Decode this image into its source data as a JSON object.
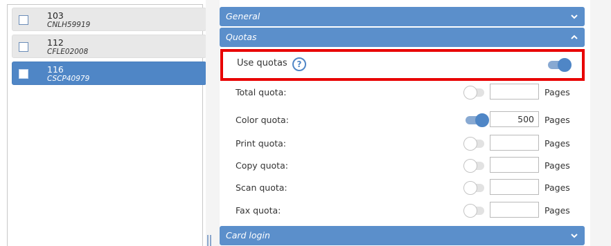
{
  "devices": [
    {
      "id": "103",
      "code": "CNLH59919",
      "selected": false
    },
    {
      "id": "112",
      "code": "CFLE02008",
      "selected": false
    },
    {
      "id": "116",
      "code": "CSCP40979",
      "selected": true
    }
  ],
  "sections": {
    "general": {
      "label": "General",
      "expanded": false
    },
    "quotas": {
      "label": "Quotas",
      "expanded": true
    },
    "card_login": {
      "label": "Card login",
      "expanded": false
    }
  },
  "use_quotas": {
    "label": "Use quotas",
    "help_glyph": "?",
    "enabled": true
  },
  "quotas": [
    {
      "label": "Total quota:",
      "enabled": false,
      "value": "",
      "unit": "Pages"
    },
    {
      "label": "Color quota:",
      "enabled": true,
      "value": "500",
      "unit": "Pages"
    },
    {
      "label": "Print quota:",
      "enabled": false,
      "value": "",
      "unit": "Pages"
    },
    {
      "label": "Copy quota:",
      "enabled": false,
      "value": "",
      "unit": "Pages"
    },
    {
      "label": "Scan quota:",
      "enabled": false,
      "value": "",
      "unit": "Pages"
    },
    {
      "label": "Fax quota:",
      "enabled": false,
      "value": "",
      "unit": "Pages"
    }
  ],
  "colors": {
    "accent": "#5b8fcb",
    "selected": "#4f86c6",
    "highlight_border": "#e80000"
  }
}
